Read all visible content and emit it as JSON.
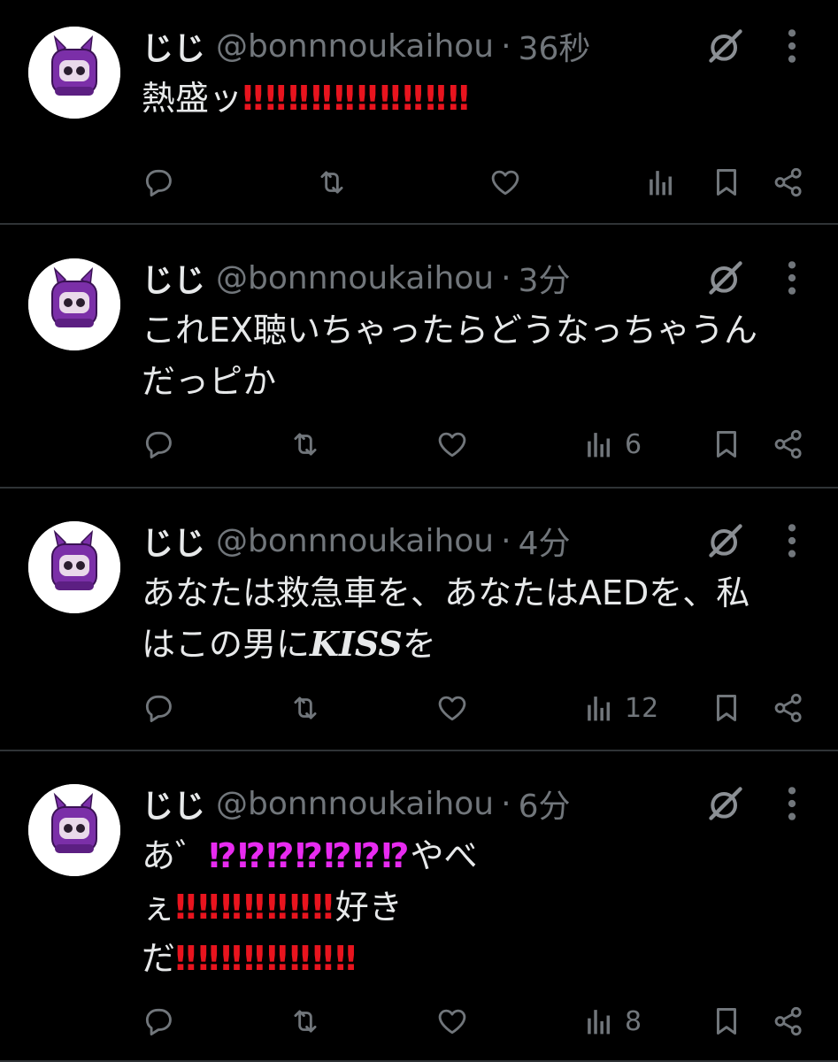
{
  "colors": {
    "background": "#000000",
    "text": "#e7e9ea",
    "muted": "#71767b",
    "divider": "#2f3336",
    "red_mark": "#e8141e",
    "magenta_mark": "#e82bf0",
    "avatar_purple": "#7b2fa8"
  },
  "icons": [
    "reply-icon",
    "retweet-icon",
    "like-icon",
    "views-icon",
    "bookmark-icon",
    "share-icon",
    "grok-icon",
    "more-icon"
  ],
  "tweets": [
    {
      "name": "じじ",
      "handle": "@bonnnoukaihou",
      "separator": "·",
      "time": "36秒",
      "text_parts": [
        "熱盛ッ",
        "‼︎‼︎‼︎‼︎‼︎‼︎‼︎‼︎‼︎‼︎"
      ],
      "views": ""
    },
    {
      "name": "じじ",
      "handle": "@bonnnoukaihou",
      "separator": "·",
      "time": "3分",
      "text_parts": [
        "これEX聴いちゃったらどうなっちゃうん\nだっピか"
      ],
      "views": "6"
    },
    {
      "name": "じじ",
      "handle": "@bonnnoukaihou",
      "separator": "·",
      "time": "4分",
      "text_parts": [
        "あなたは救急車を、あなたはAEDを、私\nはこの男に",
        "KISS",
        "を"
      ],
      "views": "12"
    },
    {
      "name": "じじ",
      "handle": "@bonnnoukaihou",
      "separator": "·",
      "time": "6分",
      "text_parts": [
        "あ゛",
        "⁉︎⁉︎⁉︎⁉︎⁉︎⁉︎⁉︎",
        "やべ\nぇ",
        "‼︎‼︎‼︎‼︎‼︎‼︎‼︎",
        "好き\nだ",
        "‼︎‼︎‼︎‼︎‼︎‼︎‼︎‼︎"
      ],
      "views": "8"
    }
  ]
}
